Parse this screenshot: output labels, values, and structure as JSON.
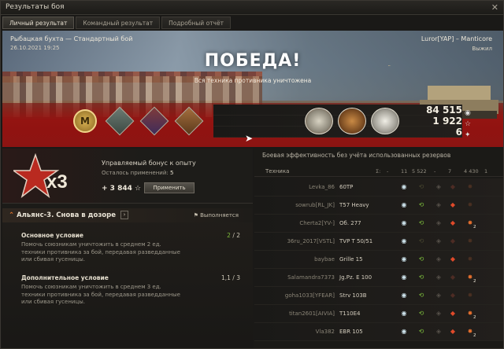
{
  "window": {
    "title": "Результаты боя",
    "close_glyph": "✕"
  },
  "tabs": [
    {
      "label": "Личный результат",
      "active": true
    },
    {
      "label": "Командный результат",
      "active": false
    },
    {
      "label": "Подробный отчёт",
      "active": false
    }
  ],
  "banner": {
    "map_name": "Рыбацкая бухта — Стандартный бой",
    "date": "26.10.2021 19:25",
    "player": "Luror[YAP] – Manticore",
    "player_status": "Выжил",
    "result": "ПОБЕДА!",
    "result_sub": "Вся техника противника уничтожена"
  },
  "medals": {
    "mastery_letter": "M",
    "left": [
      "mastery-badge-icon",
      "achievement-icon-1",
      "achievement-icon-2",
      "achievement-icon-3"
    ],
    "right": [
      "medal-icon-1",
      "medal-icon-2",
      "medal-icon-3"
    ]
  },
  "totals": {
    "credits": "84 515",
    "experience": "1 922",
    "free_exp": "6"
  },
  "bonus": {
    "title": "Управляемый бонус к опыту",
    "remaining_label": "Осталось применений:",
    "remaining_value": "5",
    "multiplier": "x3",
    "value": "+ 3 844",
    "apply_label": "Применить"
  },
  "mission": {
    "title": "Альянс-3. Снова в дозоре",
    "state": "Выполняется",
    "main_label": "Основное условие",
    "main_text": "Помочь союзникам уничтожить в среднем 2 ед. техники противника за бой, передавая разведданные или сбивая гусеницы.",
    "main_progress_done": "2",
    "main_progress_total": "/ 2",
    "extra_label": "Дополнительное условие",
    "extra_text": "Помочь союзникам уничтожить в среднем 3 ед. техники противника за бой, передавая разведданные или сбивая гусеницы.",
    "extra_progress": "1,1 / 3"
  },
  "efficiency": {
    "header": "Боевая эффективность без учёта использованных резервов",
    "col_vehicle": "Техника",
    "col_values": [
      "Σ:",
      "-",
      "11",
      "5 522",
      "-",
      "7",
      "4 430",
      "1"
    ],
    "rows": [
      {
        "player": "Levka_86",
        "vehicle": "60TP",
        "spot": true,
        "damage": false,
        "hit": false,
        "kill": false,
        "count": ""
      },
      {
        "player": "sowrub[RL_JK]",
        "vehicle": "T57 Heavy",
        "spot": true,
        "damage": true,
        "hit": true,
        "kill": false,
        "count": ""
      },
      {
        "player": "Cherta2[YV-]",
        "vehicle": "Об. 277",
        "spot": true,
        "damage": true,
        "hit": true,
        "kill": true,
        "count": "2"
      },
      {
        "player": "36ru_2017[VSTL]",
        "vehicle": "TVP T 50/51",
        "spot": true,
        "damage": false,
        "hit": false,
        "kill": false,
        "count": ""
      },
      {
        "player": "baybae",
        "vehicle": "Grille 15",
        "spot": true,
        "damage": true,
        "hit": true,
        "kill": false,
        "count": ""
      },
      {
        "player": "Salamandra7373",
        "vehicle": "Jg.Pz. E 100",
        "spot": true,
        "damage": true,
        "hit": false,
        "kill": true,
        "count": "2"
      },
      {
        "player": "goha1033[YFEAR]",
        "vehicle": "Strv 103B",
        "spot": true,
        "damage": true,
        "hit": false,
        "kill": false,
        "count": ""
      },
      {
        "player": "titan2601[AIVIA]",
        "vehicle": "T110E4",
        "spot": true,
        "damage": true,
        "hit": true,
        "kill": true,
        "count": "2"
      },
      {
        "player": "Vla382",
        "vehicle": "EBR 105",
        "spot": true,
        "damage": true,
        "hit": true,
        "kill": true,
        "count": "2"
      }
    ]
  }
}
